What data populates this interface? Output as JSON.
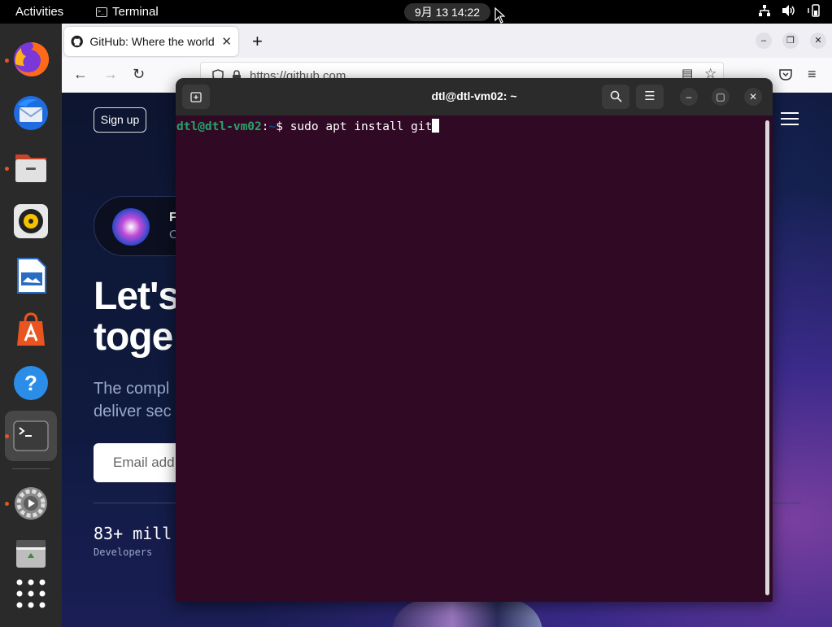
{
  "topbar": {
    "activities": "Activities",
    "app_name": "Terminal",
    "clock": "9月 13 14:22"
  },
  "dock": {
    "items": [
      "firefox",
      "thunderbird",
      "files",
      "rhythmbox",
      "libreoffice-writer",
      "ubuntu-software",
      "help",
      "terminal",
      "settings",
      "trash",
      "show-apps"
    ]
  },
  "browser": {
    "tab_title": "GitHub: Where the world",
    "url": "https://github.com",
    "page": {
      "signup": "Sign up",
      "promo_title": "F",
      "promo_sub": "C",
      "headline_line1": "Let's",
      "headline_line2": "toge",
      "subhead_line1": "The compl",
      "subhead_line2": "deliver sec",
      "email_placeholder": "Email add",
      "stat_number": "83+ mill",
      "stat_label": "Developers"
    }
  },
  "terminal": {
    "title": "dtl@dtl-vm02: ~",
    "prompt_user": "dtl@dtl-vm02",
    "prompt_sep": ":",
    "prompt_path": "~",
    "prompt_symbol": "$ ",
    "command": "sudo apt install git"
  },
  "colors": {
    "terminal_bg": "#300a24",
    "prompt_user": "#26a269",
    "prompt_path": "#12488b",
    "accent": "#e95420"
  }
}
